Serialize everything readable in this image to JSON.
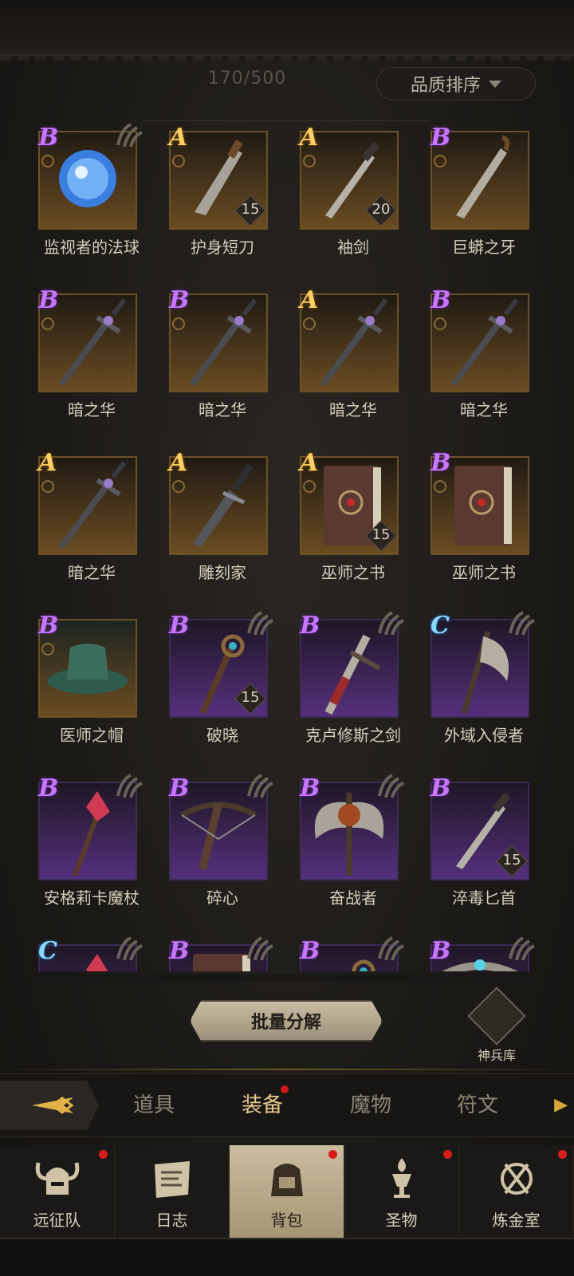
{
  "inventory": {
    "count": "170/500",
    "sort_label": "品质排序"
  },
  "items": [
    {
      "name": "监视者的法球",
      "grade": "B",
      "style": "gold",
      "icon": "orb-icon",
      "locked": true,
      "qty": ""
    },
    {
      "name": "护身短刀",
      "grade": "A",
      "style": "gold",
      "icon": "short-blade-icon",
      "locked": false,
      "qty": "15"
    },
    {
      "name": "袖剑",
      "grade": "A",
      "style": "gold",
      "icon": "dagger-icon",
      "locked": false,
      "qty": "20"
    },
    {
      "name": "巨蟒之牙",
      "grade": "B",
      "style": "gold",
      "icon": "serrated-dagger-icon",
      "locked": false,
      "qty": ""
    },
    {
      "name": "暗之华",
      "grade": "B",
      "style": "gold",
      "icon": "dark-sword-icon",
      "locked": false,
      "qty": ""
    },
    {
      "name": "暗之华",
      "grade": "B",
      "style": "gold",
      "icon": "dark-sword-icon",
      "locked": false,
      "qty": ""
    },
    {
      "name": "暗之华",
      "grade": "A",
      "style": "gold",
      "icon": "dark-sword-icon",
      "locked": false,
      "qty": ""
    },
    {
      "name": "暗之华",
      "grade": "B",
      "style": "gold",
      "icon": "dark-sword-icon",
      "locked": false,
      "qty": ""
    },
    {
      "name": "暗之华",
      "grade": "A",
      "style": "gold",
      "icon": "dark-sword-icon",
      "locked": false,
      "qty": ""
    },
    {
      "name": "雕刻家",
      "grade": "A",
      "style": "gold",
      "icon": "carver-dagger-icon",
      "locked": false,
      "qty": ""
    },
    {
      "name": "巫师之书",
      "grade": "A",
      "style": "gold",
      "icon": "spellbook-icon",
      "locked": false,
      "qty": "15"
    },
    {
      "name": "巫师之书",
      "grade": "B",
      "style": "gold",
      "icon": "spellbook-icon",
      "locked": false,
      "qty": ""
    },
    {
      "name": "医师之帽",
      "grade": "B",
      "style": "gold",
      "icon": "hat-icon",
      "locked": false,
      "qty": ""
    },
    {
      "name": "破晓",
      "grade": "B",
      "style": "purple",
      "icon": "staff-icon",
      "locked": true,
      "qty": "15"
    },
    {
      "name": "克卢修斯之剑",
      "grade": "B",
      "style": "purple",
      "icon": "greatsword-icon",
      "locked": true,
      "qty": ""
    },
    {
      "name": "外域入侵者",
      "grade": "C",
      "style": "purple",
      "icon": "axe-icon",
      "locked": true,
      "qty": ""
    },
    {
      "name": "安格莉卡魔杖",
      "grade": "B",
      "style": "purple",
      "icon": "crystal-wand-icon",
      "locked": true,
      "qty": ""
    },
    {
      "name": "碎心",
      "grade": "B",
      "style": "purple",
      "icon": "crossbow-icon",
      "locked": true,
      "qty": ""
    },
    {
      "name": "奋战者",
      "grade": "B",
      "style": "purple",
      "icon": "double-axe-icon",
      "locked": true,
      "qty": ""
    },
    {
      "name": "淬毒匕首",
      "grade": "B",
      "style": "purple",
      "icon": "dagger-icon",
      "locked": false,
      "qty": "15"
    },
    {
      "name": "",
      "grade": "C",
      "style": "purple",
      "icon": "crystal-wand-icon",
      "locked": true,
      "qty": ""
    },
    {
      "name": "",
      "grade": "B",
      "style": "purple",
      "icon": "spellbook-icon",
      "locked": true,
      "qty": ""
    },
    {
      "name": "",
      "grade": "B",
      "style": "purple",
      "icon": "staff-icon",
      "locked": true,
      "qty": ""
    },
    {
      "name": "",
      "grade": "B",
      "style": "purple",
      "icon": "circlet-icon",
      "locked": true,
      "qty": ""
    }
  ],
  "actions": {
    "bulk_dismantle": "批量分解",
    "armory": "神兵库"
  },
  "tabs": {
    "items": "道具",
    "equipment": "装备",
    "monsters": "魔物",
    "runes": "符文"
  },
  "nav": {
    "expedition": "远征队",
    "journal": "日志",
    "backpack": "背包",
    "relics": "圣物",
    "alchemy": "炼金室"
  },
  "colors": {
    "grade_A": "#ffd063",
    "grade_B": "#c676ff",
    "grade_C": "#88d8ff",
    "active_tab": "#e8c88a",
    "badge": "#d81d1d"
  }
}
